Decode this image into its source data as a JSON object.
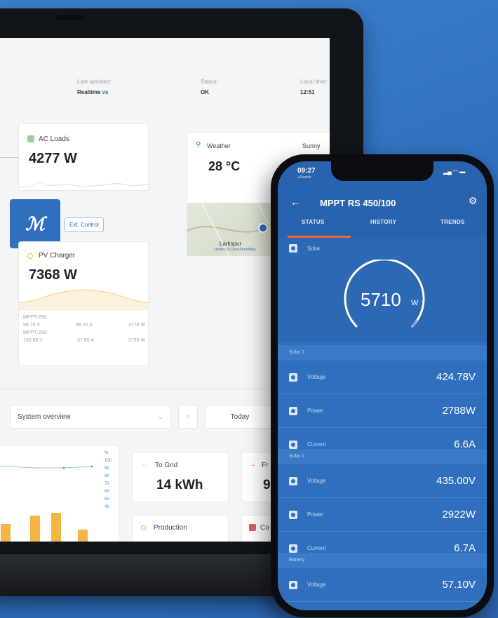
{
  "dashboard": {
    "status": {
      "last_updated_label": "Last updated:",
      "last_updated_value": "Realtime",
      "last_updated_link": "vs",
      "status_label": "Status:",
      "status_value": "OK",
      "local_time_label": "Local time:",
      "local_time_value": "12:51"
    },
    "ac_loads": {
      "title": "AC Loads",
      "value": "4277 W"
    },
    "weather": {
      "title": "Weather",
      "condition": "Sunny",
      "temp": "28 °C",
      "map_place": "Larkspur",
      "map_attrib": "Leaflet | © OpenStreetMap"
    },
    "ext_control": "Ext. Control",
    "pv_charger": {
      "title": "PV Charger",
      "value": "7368 W",
      "rows": [
        {
          "name": "MPPT-256:",
          "v": "98.75 V",
          "a": "38.26 A",
          "w": "3778 W"
        },
        {
          "name": "MPPT-258:",
          "v": "100.80 V",
          "a": "37.69 A",
          "w": "3799 W"
        }
      ]
    },
    "toolbar": {
      "overview": "System overview",
      "prev": "<",
      "range": "Today"
    },
    "chart_axis": [
      "%",
      "100",
      "90",
      "80",
      "70",
      "60",
      "50",
      "40"
    ],
    "kpis": {
      "to_grid_label": "To Grid",
      "to_grid_value": "14 kWh",
      "from_label": "Fr",
      "from_value": "9",
      "production_label": "Production",
      "consumption_label": "Co"
    }
  },
  "phone": {
    "status_time": "09:27",
    "status_back": "◂ Search",
    "title": "MPPT RS 450/100",
    "tabs": [
      "STATUS",
      "HISTORY",
      "TRENDS"
    ],
    "solar_label": "Solar",
    "gauge_value": "5710",
    "gauge_unit": "W",
    "sections": [
      {
        "title": "Solar 1",
        "rows": [
          {
            "label": "Voltage",
            "value": "424.78V"
          },
          {
            "label": "Power",
            "value": "2788W"
          },
          {
            "label": "Current",
            "value": "6.6A"
          }
        ]
      },
      {
        "title": "Solar 2",
        "rows": [
          {
            "label": "Voltage",
            "value": "435.00V"
          },
          {
            "label": "Power",
            "value": "2922W"
          },
          {
            "label": "Current",
            "value": "6.7A"
          }
        ]
      },
      {
        "title": "Battery",
        "rows": [
          {
            "label": "Voltage",
            "value": "57.10V"
          }
        ]
      }
    ]
  },
  "colors": {
    "brand_blue": "#2f6fbd",
    "bar_orange": "#f5b443",
    "background": "#3b82cf"
  }
}
